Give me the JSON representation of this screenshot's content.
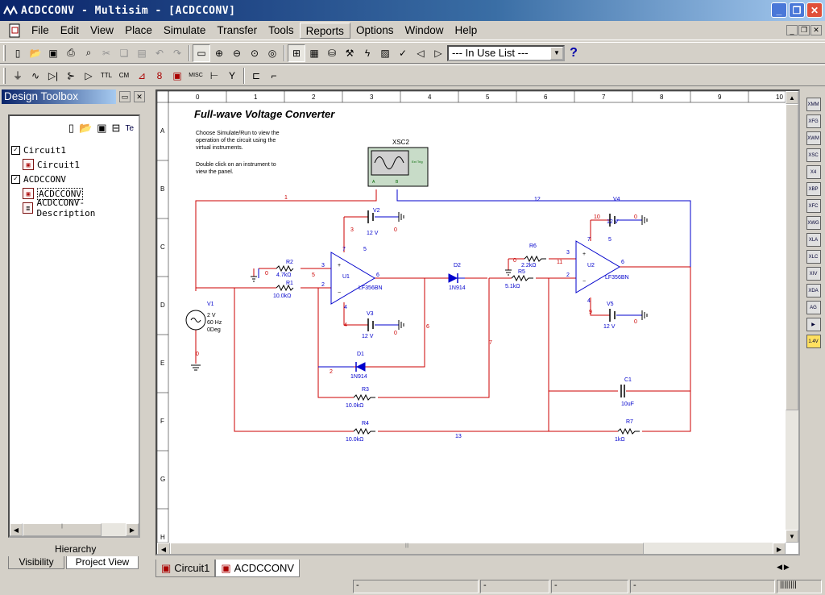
{
  "window": {
    "title": "ACDCCONV - Multisim - [ACDCCONV]",
    "min": "_",
    "max": "❐",
    "close": "✕"
  },
  "menu": [
    "File",
    "Edit",
    "View",
    "Place",
    "Simulate",
    "Transfer",
    "Tools",
    "Reports",
    "Options",
    "Window",
    "Help"
  ],
  "toolbar": {
    "in_use_list": "--- In Use List ---",
    "help_symbol": "?"
  },
  "component_toolbar": {
    "misc": "MISC"
  },
  "toolbox": {
    "title": "Design Toolbox",
    "tree": [
      {
        "label": "Circuit1",
        "level": 0,
        "checked": true
      },
      {
        "label": "Circuit1",
        "level": 1
      },
      {
        "label": "ACDCCONV",
        "level": 0,
        "checked": true
      },
      {
        "label": "ACDCCONV",
        "level": 1,
        "selected": true
      },
      {
        "label": "ACDCCONV-Description",
        "level": 1
      }
    ],
    "hierarchy_label": "Hierarchy",
    "tabs": [
      "Visibility",
      "Project View"
    ],
    "tb_text_icon": "Te"
  },
  "sheet": {
    "title": "Full-wave Voltage Converter",
    "note1": [
      "Choose Simulate/Run to view the",
      "operation of the circuit using the",
      "virtual instruments."
    ],
    "note2": [
      "Double click on an instrument to",
      "view the panel."
    ],
    "col_labels": [
      "0",
      "1",
      "2",
      "3",
      "4",
      "5",
      "6",
      "7",
      "8",
      "9",
      "10"
    ],
    "row_labels": [
      "A",
      "B",
      "C",
      "D",
      "E",
      "F",
      "G",
      "H"
    ],
    "scope": {
      "name": "XSC2",
      "ext_trig": "Ext Trig",
      "a": "A",
      "b": "B"
    },
    "components": {
      "V1": {
        "name": "V1",
        "v": "2 V",
        "f": "60 Hz",
        "ph": "0Deg"
      },
      "V2": {
        "name": "V2",
        "v": "12 V"
      },
      "V3": {
        "name": "V3",
        "v": "12 V"
      },
      "V4": {
        "name": "V4",
        "v": "12 V"
      },
      "V5": {
        "name": "V5",
        "v": "12 V"
      },
      "R1": {
        "name": "R1",
        "v": "10.0kΩ"
      },
      "R2": {
        "name": "R2",
        "v": "4.7kΩ"
      },
      "R3": {
        "name": "R3",
        "v": "10.0kΩ"
      },
      "R4": {
        "name": "R4",
        "v": "10.0kΩ"
      },
      "R5": {
        "name": "R5",
        "v": "5.1kΩ"
      },
      "R6": {
        "name": "R6",
        "v": "2.2kΩ"
      },
      "R7": {
        "name": "R7",
        "v": "1kΩ"
      },
      "C1": {
        "name": "C1",
        "v": "10uF"
      },
      "D1": {
        "name": "D1",
        "v": "1N914"
      },
      "D2": {
        "name": "D2",
        "v": "1N914"
      },
      "U1": {
        "name": "U1",
        "v": "LF356BN"
      },
      "U2": {
        "name": "U2",
        "v": "LF356BN"
      }
    },
    "nets": {
      "n0": "0",
      "n1": "1",
      "n2": "2",
      "n3": "3",
      "n4": "4",
      "n5": "5",
      "n6": "6",
      "n7": "7",
      "n9": "9",
      "n10": "10",
      "n11": "11",
      "n12": "12",
      "n13": "13"
    },
    "pins": {
      "p2": "2",
      "p3": "3",
      "p4": "4",
      "p5": "5",
      "p6": "6",
      "p7": "7",
      "plus": "+",
      "minus": "−"
    }
  },
  "tabs": [
    "Circuit1",
    "ACDCCONV"
  ],
  "status": [
    "-",
    "-",
    "-",
    "-"
  ],
  "colors": {
    "wire_red": "#cc0000",
    "wire_blue": "#0000cc",
    "title_start": "#0a246a"
  }
}
